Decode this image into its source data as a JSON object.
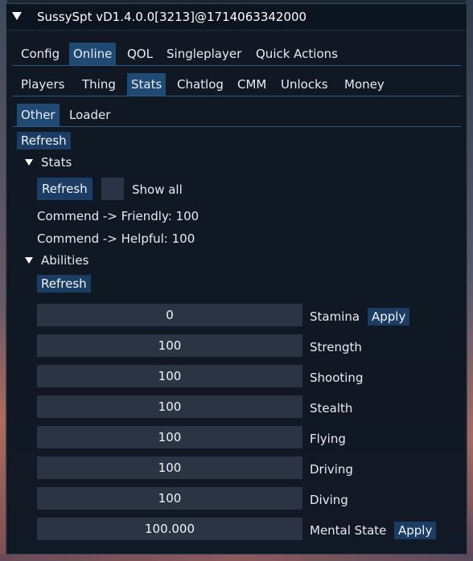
{
  "window": {
    "title": "SussySpt vD1.4.0.0[3213]@1714063342000"
  },
  "main_tabs": [
    {
      "label": "Config"
    },
    {
      "label": "Online"
    },
    {
      "label": "QOL"
    },
    {
      "label": "Singleplayer"
    },
    {
      "label": "Quick Actions"
    }
  ],
  "online_tabs": [
    {
      "label": "Players"
    },
    {
      "label": "Thing"
    },
    {
      "label": "Stats"
    },
    {
      "label": "Chatlog"
    },
    {
      "label": "CMM"
    },
    {
      "label": "Unlocks"
    },
    {
      "label": "Money"
    }
  ],
  "stats_tabs": [
    {
      "label": "Other"
    },
    {
      "label": "Loader"
    }
  ],
  "top_refresh": "Refresh",
  "stats_section": {
    "header": "Stats",
    "refresh": "Refresh",
    "show_all": "Show all",
    "lines": [
      "Commend -> Friendly: 100",
      "Commend -> Helpful: 100"
    ]
  },
  "abilities_section": {
    "header": "Abilities",
    "refresh": "Refresh",
    "apply": "Apply",
    "rows": [
      {
        "value": "0",
        "label": "Stamina"
      },
      {
        "value": "100",
        "label": "Strength"
      },
      {
        "value": "100",
        "label": "Shooting"
      },
      {
        "value": "100",
        "label": "Stealth"
      },
      {
        "value": "100",
        "label": "Flying"
      },
      {
        "value": "100",
        "label": "Driving"
      },
      {
        "value": "100",
        "label": "Diving"
      },
      {
        "value": "100.000",
        "label": "Mental State"
      }
    ]
  },
  "colors": {
    "accent": "#1f4a73",
    "button": "#1b3d63",
    "field": "#2b3442"
  }
}
